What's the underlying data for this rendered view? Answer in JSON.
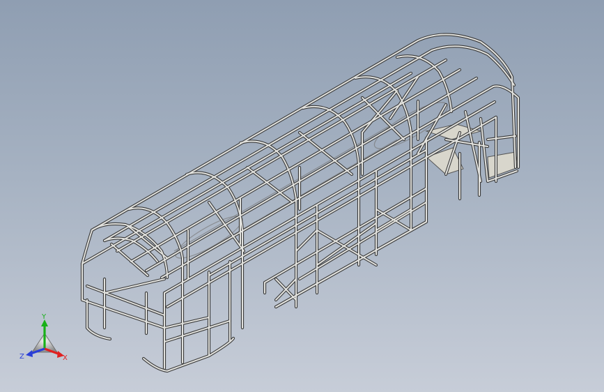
{
  "viewport": {
    "background_top": "#8f9eb2",
    "background_bottom": "#c7cdd8"
  },
  "model": {
    "name": "bus-body-frame",
    "frame_color": "#d9d9d6",
    "edge_color": "#3d3d3d"
  },
  "triad": {
    "x_label": "X",
    "y_label": "Y",
    "z_label": "Z",
    "x_color": "#e02020",
    "y_color": "#18b018",
    "z_color": "#2a3fd8"
  }
}
